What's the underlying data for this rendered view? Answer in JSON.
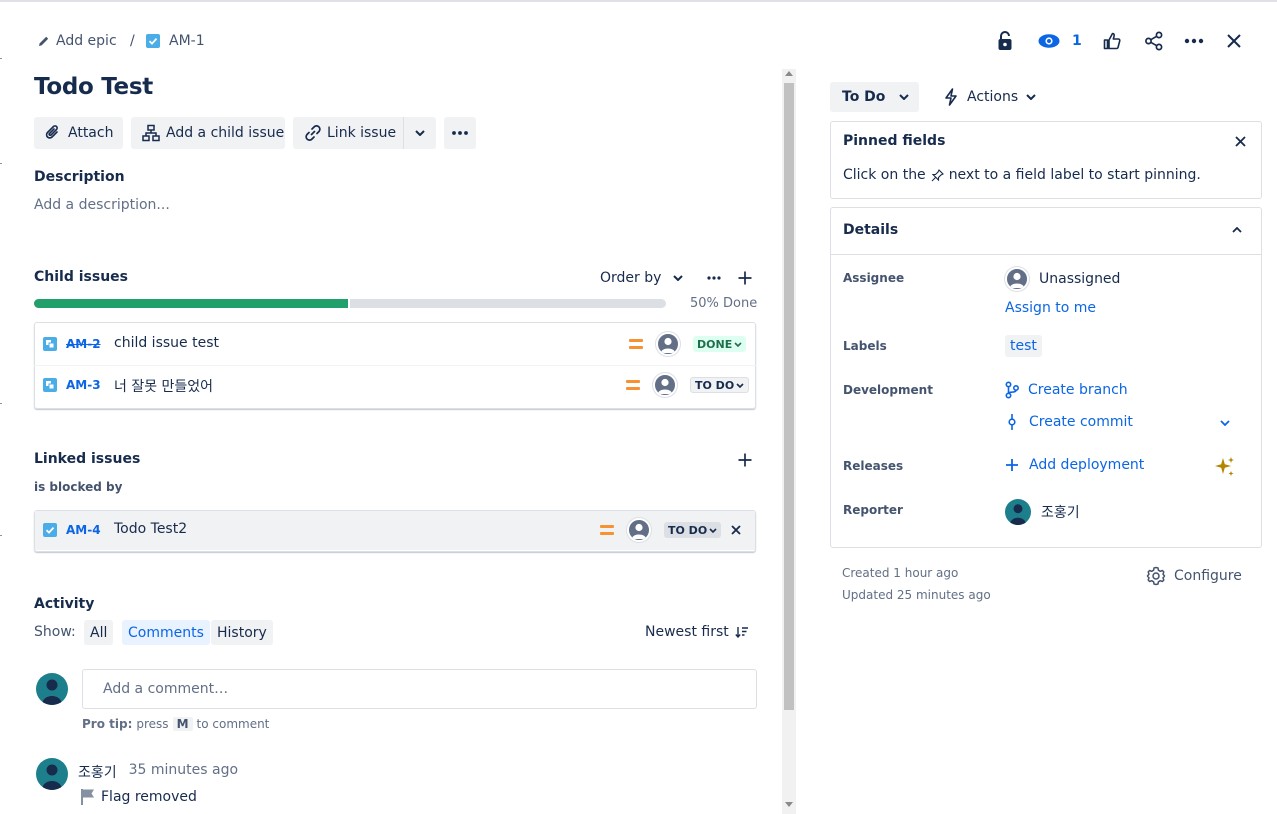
{
  "breadcrumb": {
    "add_epic": "Add epic",
    "separator": "/",
    "issue_key": "AM-1"
  },
  "header": {
    "watch_count": "1"
  },
  "issue": {
    "title": "Todo Test"
  },
  "toolbar": {
    "attach": "Attach",
    "add_child": "Add a child issue",
    "link_issue": "Link issue"
  },
  "description": {
    "heading": "Description",
    "placeholder": "Add a description..."
  },
  "child_issues": {
    "heading": "Child issues",
    "order_by": "Order by",
    "progress_percent": 50,
    "progress_text": "50% Done",
    "items": [
      {
        "key": "AM-2",
        "summary": "child issue test",
        "status": "DONE"
      },
      {
        "key": "AM-3",
        "summary": "너 잘못 만들었어",
        "status": "TO DO"
      }
    ]
  },
  "linked_issues": {
    "heading": "Linked issues",
    "relation": "is blocked by",
    "items": [
      {
        "key": "AM-4",
        "summary": "Todo Test2",
        "status": "TO DO"
      }
    ]
  },
  "activity": {
    "heading": "Activity",
    "show_label": "Show:",
    "tabs": [
      "All",
      "Comments",
      "History"
    ],
    "active_tab": "Comments",
    "sort": "Newest first",
    "comment_placeholder": "Add a comment…",
    "pro_tip_bold": "Pro tip:",
    "pro_tip_press": "press",
    "pro_tip_key": "M",
    "pro_tip_rest": "to comment",
    "entry": {
      "author": "조홍기",
      "time": "35 minutes ago",
      "text": "Flag removed"
    }
  },
  "sidebar": {
    "status": "To Do",
    "actions": "Actions",
    "pinned": {
      "heading": "Pinned fields",
      "hint_before": "Click on the",
      "hint_after": "next to a field label to start pinning."
    },
    "details": {
      "heading": "Details",
      "assignee_label": "Assignee",
      "assignee_value": "Unassigned",
      "assign_to_me": "Assign to me",
      "labels_label": "Labels",
      "label_value": "test",
      "development_label": "Development",
      "create_branch": "Create branch",
      "create_commit": "Create commit",
      "releases_label": "Releases",
      "add_deployment": "Add deployment",
      "reporter_label": "Reporter",
      "reporter_value": "조홍기"
    },
    "created": "Created 1 hour ago",
    "updated": "Updated 25 minutes ago",
    "configure": "Configure"
  },
  "colors": {
    "accent": "#0c66e4",
    "done": "#22a06b",
    "priority": "#f79232",
    "teal_avatar": "#1d7f8c"
  }
}
